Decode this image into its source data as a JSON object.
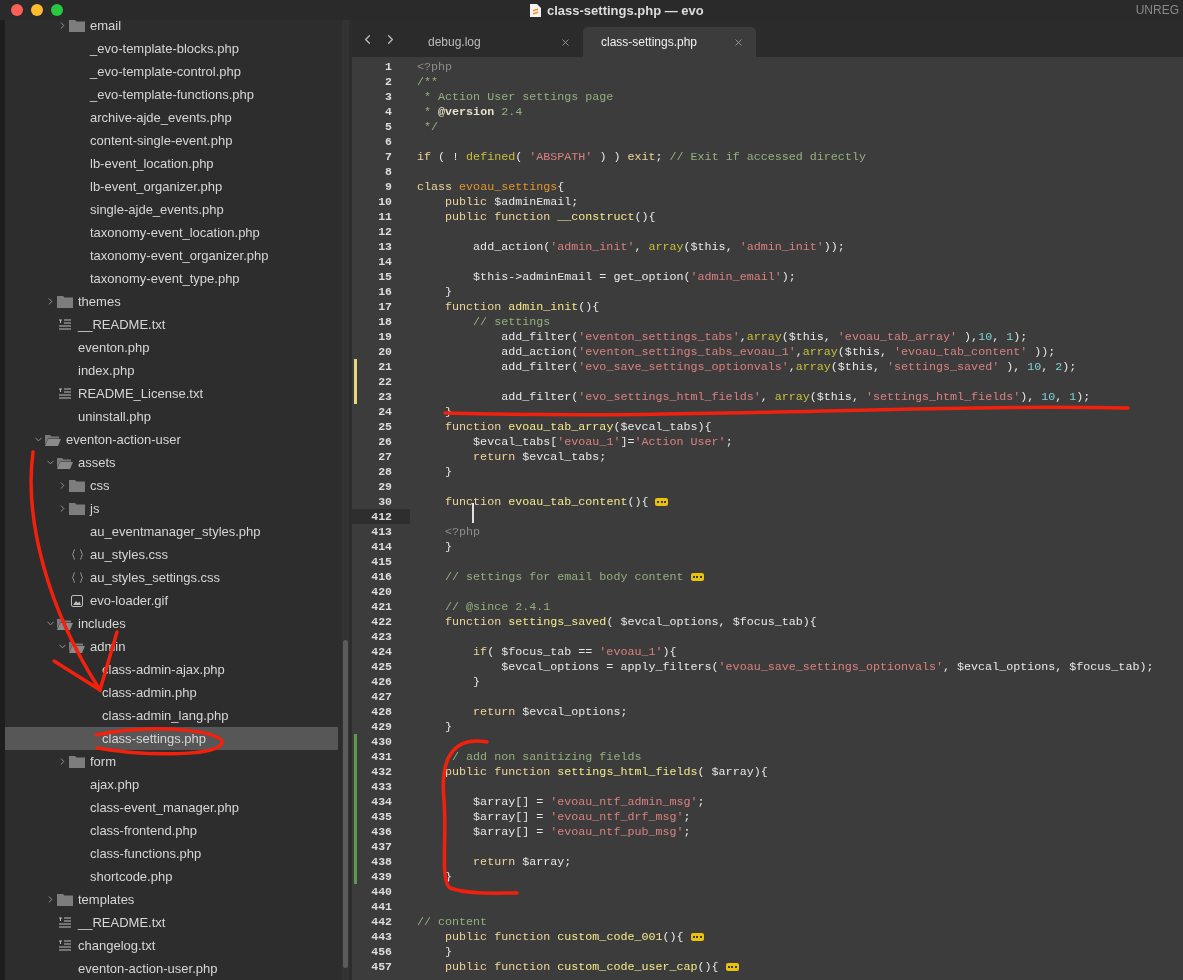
{
  "window": {
    "title": "class-settings.php — evo",
    "badge": "UNREG"
  },
  "tabs": [
    {
      "label": "debug.log",
      "selected": false
    },
    {
      "label": "class-settings.php",
      "selected": true
    }
  ],
  "tree": [
    {
      "kind": "group",
      "children": [
        {
          "kind": "group",
          "children": [
            {
              "label": "email",
              "kind": "folder",
              "expanded": false,
              "selected": false
            },
            {
              "label": "_evo-template-blocks.php",
              "selected": false
            },
            {
              "label": "_evo-template-control.php",
              "selected": false
            },
            {
              "label": "_evo-template-functions.php",
              "selected": false
            },
            {
              "label": "archive-ajde_events.php",
              "selected": false
            },
            {
              "label": "content-single-event.php",
              "selected": false
            },
            {
              "label": "lb-event_location.php",
              "selected": false
            },
            {
              "label": "lb-event_organizer.php",
              "selected": false
            },
            {
              "label": "single-ajde_events.php",
              "selected": false
            },
            {
              "label": "taxonomy-event_location.php",
              "selected": false
            },
            {
              "label": "taxonomy-event_organizer.php",
              "selected": false
            },
            {
              "label": "taxonomy-event_type.php",
              "selected": false
            }
          ]
        },
        {
          "label": "themes",
          "kind": "folder",
          "expanded": false,
          "selected": false
        },
        {
          "label": "__README.txt",
          "kind": "text",
          "selected": false
        },
        {
          "label": "eventon.php",
          "selected": false
        },
        {
          "label": "index.php",
          "selected": false
        },
        {
          "label": "README_License.txt",
          "kind": "text",
          "selected": false
        },
        {
          "label": "uninstall.php",
          "selected": false
        }
      ]
    },
    {
      "label": "eventon-action-user",
      "kind": "folder",
      "expanded": true,
      "selected": false,
      "children": [
        {
          "label": "assets",
          "kind": "folder",
          "expanded": true,
          "selected": false,
          "children": [
            {
              "label": "css",
              "kind": "folder",
              "expanded": false,
              "selected": false
            },
            {
              "label": "js",
              "kind": "folder",
              "expanded": false,
              "selected": false
            },
            {
              "label": "au_eventmanager_styles.php",
              "selected": false
            },
            {
              "label": "au_styles.css",
              "kind": "css",
              "selected": false
            },
            {
              "label": "au_styles_settings.css",
              "kind": "css",
              "selected": false
            },
            {
              "label": "evo-loader.gif",
              "kind": "image",
              "selected": false
            }
          ]
        },
        {
          "label": "includes",
          "kind": "folder",
          "expanded": true,
          "selected": false,
          "children": [
            {
              "label": "admin",
              "kind": "folder",
              "expanded": true,
              "selected": false,
              "children": [
                {
                  "label": "class-admin-ajax.php",
                  "selected": false
                },
                {
                  "label": "class-admin.php",
                  "selected": false
                },
                {
                  "label": "class-admin_lang.php",
                  "selected": false
                },
                {
                  "label": "class-settings.php",
                  "selected": true
                }
              ]
            },
            {
              "label": "form",
              "kind": "folder",
              "expanded": false,
              "selected": false
            },
            {
              "label": "ajax.php",
              "selected": false
            },
            {
              "label": "class-event_manager.php",
              "selected": false
            },
            {
              "label": "class-frontend.php",
              "selected": false
            },
            {
              "label": "class-functions.php",
              "selected": false
            },
            {
              "label": "shortcode.php",
              "selected": false
            }
          ]
        },
        {
          "label": "templates",
          "kind": "folder",
          "expanded": false,
          "selected": false
        },
        {
          "label": "__README.txt",
          "kind": "text",
          "selected": false
        },
        {
          "label": "changelog.txt",
          "kind": "text",
          "selected": false
        },
        {
          "label": "eventon-action-user.php",
          "selected": false
        }
      ]
    }
  ],
  "lines": [
    {
      "number": "1",
      "tokens": [
        {
          "kind": "tag",
          "text": "<?php"
        }
      ]
    },
    {
      "number": "2",
      "tokens": [
        {
          "kind": "cmt",
          "text": "/**"
        }
      ]
    },
    {
      "number": "3",
      "tokens": [
        {
          "kind": "cmt",
          "text": " * Action User settings page"
        }
      ]
    },
    {
      "number": "4",
      "tokens": [
        {
          "kind": "cmt",
          "text": " * "
        },
        {
          "kind": "doc",
          "text": "@version"
        },
        {
          "kind": "cmt",
          "text": " 2.4"
        }
      ]
    },
    {
      "number": "5",
      "tokens": [
        {
          "kind": "cmt",
          "text": " */"
        }
      ]
    },
    {
      "number": "6"
    },
    {
      "number": "7",
      "tokens": [
        {
          "kind": "kw",
          "text": "if"
        },
        {
          "kind": "p",
          "text": " ( ! "
        },
        {
          "kind": "bi",
          "text": "defined"
        },
        {
          "kind": "p",
          "text": "( "
        },
        {
          "kind": "str",
          "text": "'ABSPATH'"
        },
        {
          "kind": "p",
          "text": " ) ) "
        },
        {
          "kind": "kw",
          "text": "exit"
        },
        {
          "kind": "p",
          "text": "; "
        },
        {
          "kind": "cmt",
          "text": "// Exit if accessed directly"
        }
      ]
    },
    {
      "number": "8"
    },
    {
      "number": "9",
      "tokens": [
        {
          "kind": "kw",
          "text": "class "
        },
        {
          "kind": "name",
          "text": "evoau_settings"
        },
        {
          "kind": "p",
          "text": "{"
        }
      ]
    },
    {
      "number": "10",
      "tokens": [
        {
          "kind": "kw",
          "text": "    public"
        },
        {
          "kind": "p",
          "text": " $adminEmail;"
        }
      ]
    },
    {
      "number": "11",
      "tokens": [
        {
          "kind": "kw",
          "text": "    public function "
        },
        {
          "kind": "fn",
          "text": "__construct"
        },
        {
          "kind": "p",
          "text": "(){"
        }
      ]
    },
    {
      "number": "12"
    },
    {
      "number": "13",
      "tokens": [
        {
          "kind": "p",
          "text": "        add_action("
        },
        {
          "kind": "str",
          "text": "'admin_init'"
        },
        {
          "kind": "p",
          "text": ", "
        },
        {
          "kind": "bi",
          "text": "array"
        },
        {
          "kind": "p",
          "text": "($this, "
        },
        {
          "kind": "str",
          "text": "'admin_init'"
        },
        {
          "kind": "p",
          "text": "));"
        }
      ]
    },
    {
      "number": "14"
    },
    {
      "number": "15",
      "tokens": [
        {
          "kind": "p",
          "text": "        $this->adminEmail = get_option("
        },
        {
          "kind": "str",
          "text": "'admin_email'"
        },
        {
          "kind": "p",
          "text": ");"
        }
      ]
    },
    {
      "number": "16",
      "tokens": [
        {
          "kind": "p",
          "text": "    }"
        }
      ]
    },
    {
      "number": "17",
      "tokens": [
        {
          "kind": "kw",
          "text": "    function "
        },
        {
          "kind": "fn",
          "text": "admin_init"
        },
        {
          "kind": "p",
          "text": "(){"
        }
      ]
    },
    {
      "number": "18",
      "tokens": [
        {
          "kind": "cmt",
          "text": "        // settings"
        }
      ]
    },
    {
      "number": "19",
      "tokens": [
        {
          "kind": "p",
          "text": "            add_filter("
        },
        {
          "kind": "str",
          "text": "'eventon_settings_tabs'"
        },
        {
          "kind": "p",
          "text": ","
        },
        {
          "kind": "bi",
          "text": "array"
        },
        {
          "kind": "p",
          "text": "($this, "
        },
        {
          "kind": "str",
          "text": "'evoau_tab_array'"
        },
        {
          "kind": "p",
          "text": " ),"
        },
        {
          "kind": "num",
          "text": "10"
        },
        {
          "kind": "p",
          "text": ", "
        },
        {
          "kind": "num",
          "text": "1"
        },
        {
          "kind": "p",
          "text": ");"
        }
      ]
    },
    {
      "number": "20",
      "tokens": [
        {
          "kind": "p",
          "text": "            add_action("
        },
        {
          "kind": "str",
          "text": "'eventon_settings_tabs_evoau_1'"
        },
        {
          "kind": "p",
          "text": ","
        },
        {
          "kind": "bi",
          "text": "array"
        },
        {
          "kind": "p",
          "text": "($this, "
        },
        {
          "kind": "str",
          "text": "'evoau_tab_content'"
        },
        {
          "kind": "p",
          "text": " ));"
        }
      ]
    },
    {
      "number": "21",
      "kind": "modified",
      "tokens": [
        {
          "kind": "p",
          "text": "            add_filter("
        },
        {
          "kind": "str",
          "text": "'evo_save_settings_optionvals'"
        },
        {
          "kind": "p",
          "text": ","
        },
        {
          "kind": "bi",
          "text": "array"
        },
        {
          "kind": "p",
          "text": "($this, "
        },
        {
          "kind": "str",
          "text": "'settings_saved'"
        },
        {
          "kind": "p",
          "text": " ), "
        },
        {
          "kind": "num",
          "text": "10"
        },
        {
          "kind": "p",
          "text": ", "
        },
        {
          "kind": "num",
          "text": "2"
        },
        {
          "kind": "p",
          "text": ");"
        }
      ]
    },
    {
      "number": "22",
      "kind": "modified"
    },
    {
      "number": "23",
      "kind": "modified",
      "tokens": [
        {
          "kind": "p",
          "text": "            add_filter("
        },
        {
          "kind": "str",
          "text": "'evo_settings_html_fields'"
        },
        {
          "kind": "p",
          "text": ", "
        },
        {
          "kind": "bi",
          "text": "array"
        },
        {
          "kind": "p",
          "text": "($this, "
        },
        {
          "kind": "str",
          "text": "'settings_html_fields'"
        },
        {
          "kind": "p",
          "text": "), "
        },
        {
          "kind": "num",
          "text": "10"
        },
        {
          "kind": "p",
          "text": ", "
        },
        {
          "kind": "num",
          "text": "1"
        },
        {
          "kind": "p",
          "text": ");"
        }
      ]
    },
    {
      "number": "24",
      "tokens": [
        {
          "kind": "p",
          "text": "    }"
        }
      ]
    },
    {
      "number": "25",
      "tokens": [
        {
          "kind": "kw",
          "text": "    function "
        },
        {
          "kind": "fn",
          "text": "evoau_tab_array"
        },
        {
          "kind": "p",
          "text": "($evcal_tabs){"
        }
      ]
    },
    {
      "number": "26",
      "tokens": [
        {
          "kind": "p",
          "text": "        $evcal_tabs["
        },
        {
          "kind": "str",
          "text": "'evoau_1'"
        },
        {
          "kind": "p",
          "text": "]="
        },
        {
          "kind": "str",
          "text": "'Action User'"
        },
        {
          "kind": "p",
          "text": ";"
        }
      ]
    },
    {
      "number": "27",
      "tokens": [
        {
          "kind": "kw",
          "text": "        return"
        },
        {
          "kind": "p",
          "text": " $evcal_tabs;"
        }
      ]
    },
    {
      "number": "28",
      "tokens": [
        {
          "kind": "p",
          "text": "    }"
        }
      ]
    },
    {
      "number": "29"
    },
    {
      "number": "30",
      "tokens": [
        {
          "kind": "kw",
          "text": "    function "
        },
        {
          "kind": "fn",
          "text": "evoau_tab_content"
        },
        {
          "kind": "p",
          "text": "(){ "
        },
        {
          "kind": "fold"
        }
      ]
    },
    {
      "number": "412",
      "cursor": true
    },
    {
      "number": "413",
      "tokens": [
        {
          "kind": "tag",
          "text": "    <?php"
        }
      ]
    },
    {
      "number": "414",
      "tokens": [
        {
          "kind": "p",
          "text": "    }"
        }
      ]
    },
    {
      "number": "415"
    },
    {
      "number": "416",
      "tokens": [
        {
          "kind": "cmt",
          "text": "    // settings for email body content "
        },
        {
          "kind": "fold"
        }
      ]
    },
    {
      "number": "420"
    },
    {
      "number": "421",
      "tokens": [
        {
          "kind": "cmt",
          "text": "    // @since 2.4.1"
        }
      ]
    },
    {
      "number": "422",
      "tokens": [
        {
          "kind": "kw",
          "text": "    function "
        },
        {
          "kind": "fn",
          "text": "settings_saved"
        },
        {
          "kind": "p",
          "text": "( $evcal_options, $focus_tab){"
        }
      ]
    },
    {
      "number": "423"
    },
    {
      "number": "424",
      "tokens": [
        {
          "kind": "kw",
          "text": "        if"
        },
        {
          "kind": "p",
          "text": "( $focus_tab == "
        },
        {
          "kind": "str",
          "text": "'evoau_1'"
        },
        {
          "kind": "p",
          "text": "){"
        }
      ]
    },
    {
      "number": "425",
      "tokens": [
        {
          "kind": "p",
          "text": "            $evcal_options = apply_filters("
        },
        {
          "kind": "str",
          "text": "'evoau_save_settings_optionvals'"
        },
        {
          "kind": "p",
          "text": ", $evcal_options, $focus_tab);"
        }
      ]
    },
    {
      "number": "426",
      "tokens": [
        {
          "kind": "p",
          "text": "        }"
        }
      ]
    },
    {
      "number": "427"
    },
    {
      "number": "428",
      "tokens": [
        {
          "kind": "kw",
          "text": "        return"
        },
        {
          "kind": "p",
          "text": " $evcal_options;"
        }
      ]
    },
    {
      "number": "429",
      "tokens": [
        {
          "kind": "p",
          "text": "    }"
        }
      ]
    },
    {
      "number": "430",
      "kind": "added"
    },
    {
      "number": "431",
      "kind": "added",
      "tokens": [
        {
          "kind": "cmt",
          "text": "    // add non sanitizing fields"
        }
      ]
    },
    {
      "number": "432",
      "kind": "added",
      "tokens": [
        {
          "kind": "kw",
          "text": "    public function "
        },
        {
          "kind": "fn",
          "text": "settings_html_fields"
        },
        {
          "kind": "p",
          "text": "( $array){"
        }
      ]
    },
    {
      "number": "433",
      "kind": "added"
    },
    {
      "number": "434",
      "kind": "added",
      "tokens": [
        {
          "kind": "p",
          "text": "        $array[] = "
        },
        {
          "kind": "str",
          "text": "'evoau_ntf_admin_msg'"
        },
        {
          "kind": "p",
          "text": ";"
        }
      ]
    },
    {
      "number": "435",
      "kind": "added",
      "tokens": [
        {
          "kind": "p",
          "text": "        $array[] = "
        },
        {
          "kind": "str",
          "text": "'evoau_ntf_drf_msg'"
        },
        {
          "kind": "p",
          "text": ";"
        }
      ]
    },
    {
      "number": "436",
      "kind": "added",
      "tokens": [
        {
          "kind": "p",
          "text": "        $array[] = "
        },
        {
          "kind": "str",
          "text": "'evoau_ntf_pub_msg'"
        },
        {
          "kind": "p",
          "text": ";"
        }
      ]
    },
    {
      "number": "437",
      "kind": "added"
    },
    {
      "number": "438",
      "kind": "added",
      "tokens": [
        {
          "kind": "kw",
          "text": "        return"
        },
        {
          "kind": "p",
          "text": " $array;"
        }
      ]
    },
    {
      "number": "439",
      "kind": "added",
      "tokens": [
        {
          "kind": "p",
          "text": "    }"
        }
      ]
    },
    {
      "number": "440"
    },
    {
      "number": "441"
    },
    {
      "number": "442",
      "tokens": [
        {
          "kind": "cmt",
          "text": "// content"
        }
      ]
    },
    {
      "number": "443",
      "tokens": [
        {
          "kind": "kw",
          "text": "    public function "
        },
        {
          "kind": "fn",
          "text": "custom_code_001"
        },
        {
          "kind": "p",
          "text": "(){ "
        },
        {
          "kind": "fold"
        }
      ]
    },
    {
      "number": "456",
      "tokens": [
        {
          "kind": "p",
          "text": "    }"
        }
      ]
    },
    {
      "number": "457",
      "tokens": [
        {
          "kind": "kw",
          "text": "    public function "
        },
        {
          "kind": "fn",
          "text": "custom_code_user_cap"
        },
        {
          "kind": "p",
          "text": "(){ "
        },
        {
          "kind": "fold"
        }
      ]
    }
  ]
}
